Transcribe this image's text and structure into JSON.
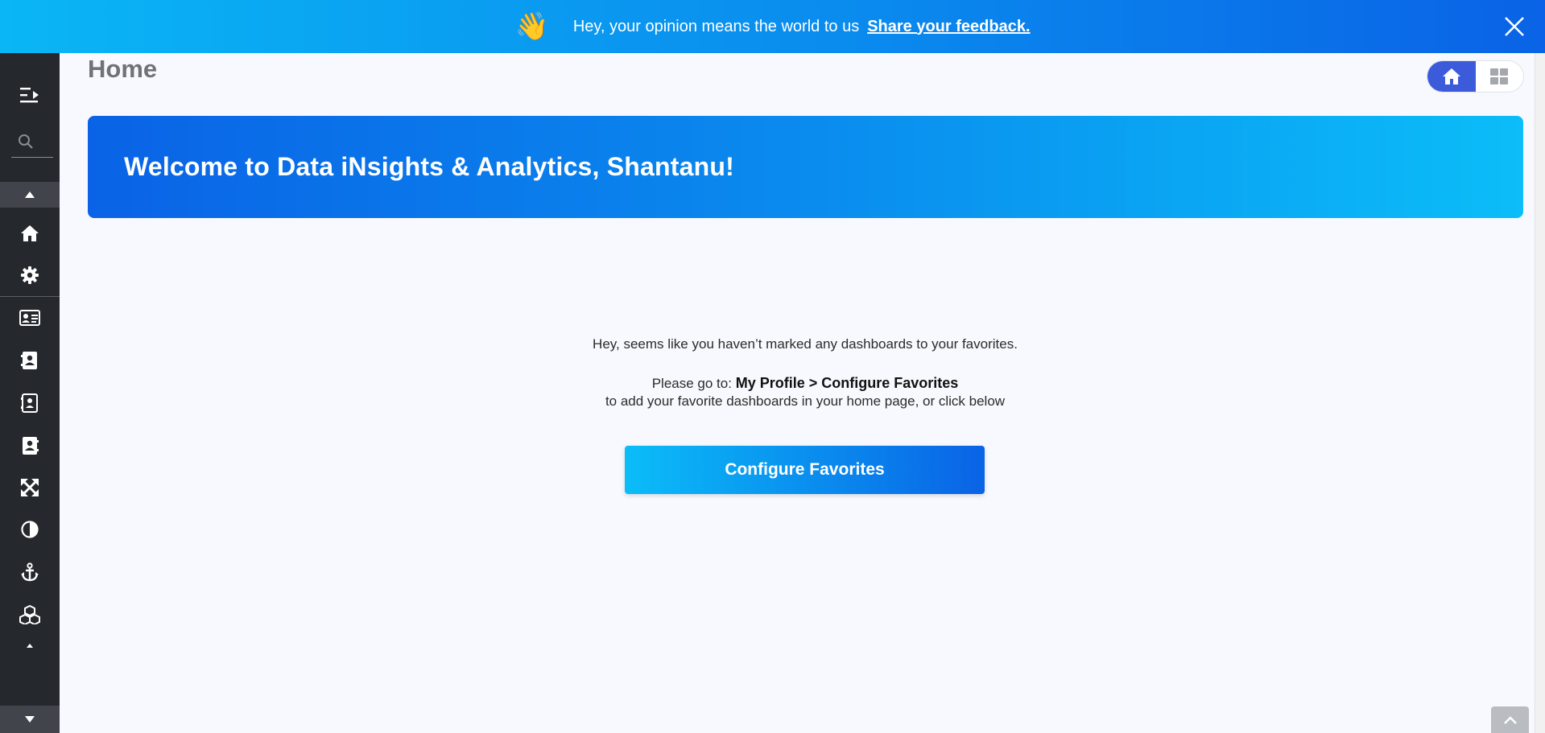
{
  "banner": {
    "emoji": "👋",
    "message": "Hey, your opinion means the world to us",
    "link_text": "Share your feedback."
  },
  "sidebar": {
    "icons": [
      "collapse-menu-icon",
      "search-icon",
      "scroll-up-icon",
      "home-icon",
      "gear-icon",
      "id-card-icon",
      "contact-book-icon",
      "contact-book-outline-icon",
      "contact-book-alt-icon",
      "expand-arrows-icon",
      "contrast-icon",
      "anchor-icon",
      "cubes-icon",
      "small-caret-icon",
      "scroll-down-icon"
    ]
  },
  "page": {
    "title": "Home"
  },
  "welcome": {
    "heading": "Welcome to Data iNsights & Analytics, Shantanu!"
  },
  "empty_state": {
    "line1": "Hey, seems like you haven’t marked any dashboards to your favorites.",
    "line2_prefix": "Please go to:",
    "line2_path": "My Profile > Configure Favorites",
    "line3": "to add your favorite dashboards in your home page, or click below",
    "button_label": "Configure Favorites"
  },
  "colors": {
    "banner_start": "#0ab6f5",
    "banner_end": "#0a63e6",
    "sidebar_bg": "#25282d",
    "toggle_active": "#3b5bdb",
    "page_bg": "#f7f9fe"
  }
}
